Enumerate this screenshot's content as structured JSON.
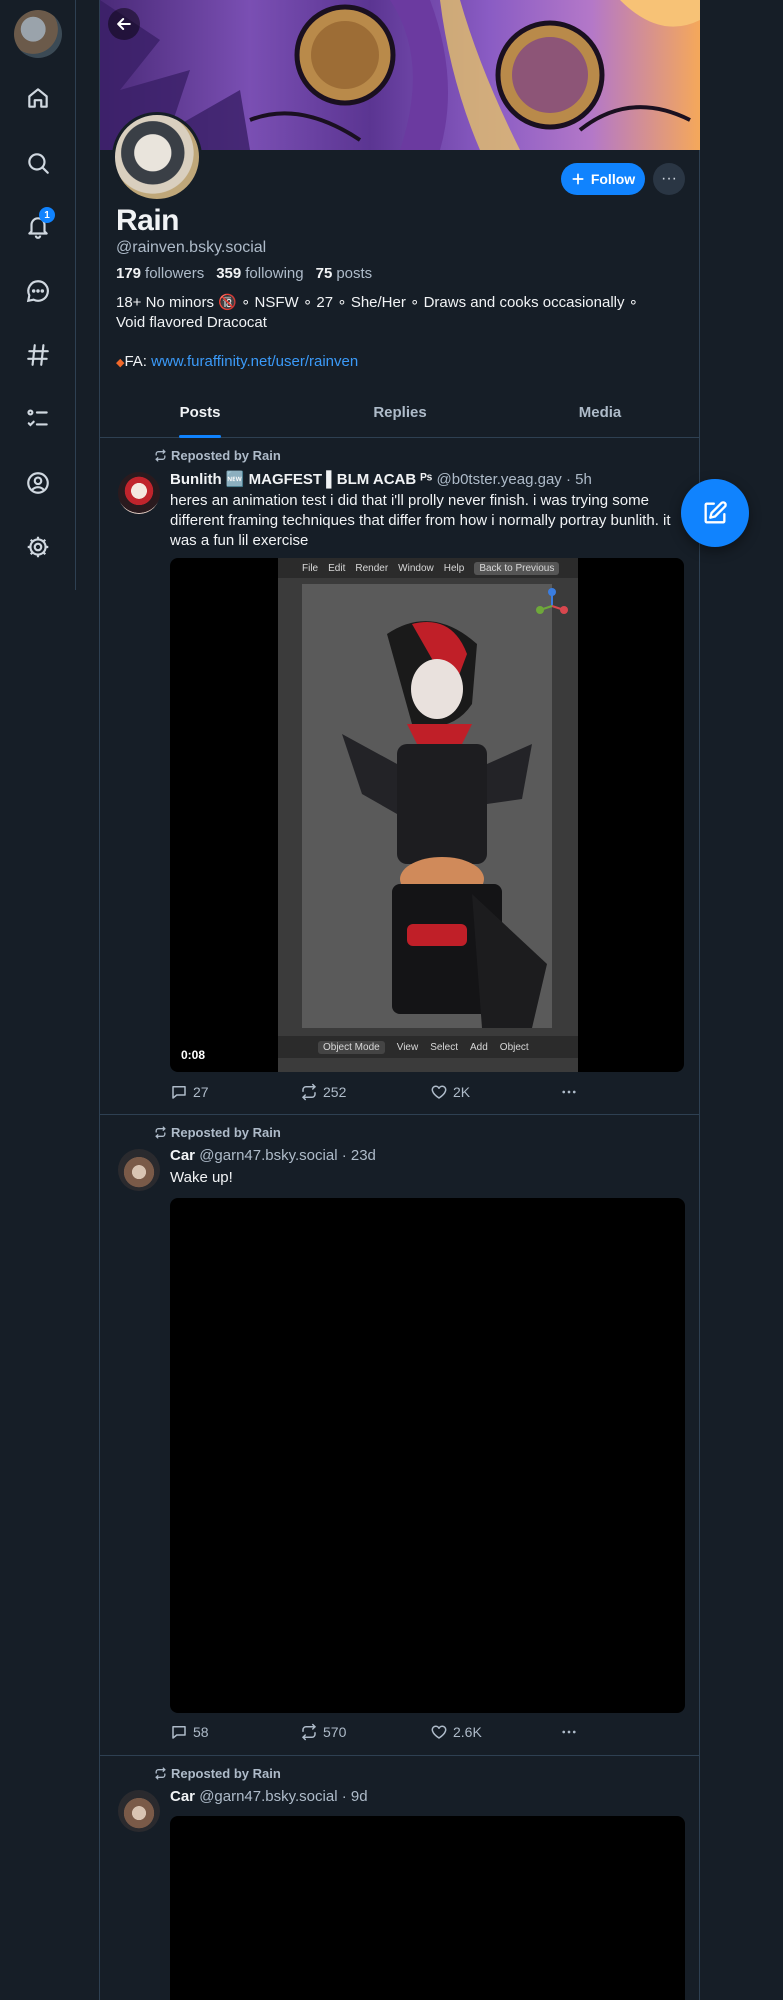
{
  "nav": {
    "notification_count": "1",
    "items": [
      "home",
      "search",
      "notifications",
      "chat",
      "feeds",
      "lists",
      "profile",
      "settings"
    ]
  },
  "profile": {
    "display_name": "Rain",
    "handle": "@rainven.bsky.social",
    "followers_count": "179",
    "followers_label": "followers",
    "following_count": "359",
    "following_label": "following",
    "posts_count": "75",
    "posts_label": "posts",
    "bio_line1": "18+ No minors 🔞 ∘ NSFW ∘ 27 ∘ She/Her ∘ Draws and cooks occasionally ∘",
    "bio_line2": "Void flavored Dracocat",
    "link_prefix": "FA: ",
    "link_url": "www.furaffinity.net/user/rainven",
    "follow_label": "Follow",
    "more_label": "···"
  },
  "tabs": [
    "Posts",
    "Replies",
    "Media"
  ],
  "posts": [
    {
      "repost_label": "Reposted by Rain",
      "author": "Bunlith 🆕 MAGFEST ▌BLM ACAB ᴾˢ",
      "meta": "@b0tster.yeag.gay · 5h",
      "text": "heres an animation test i did that i'll prolly never finish. i was trying some different framing techniques that differ from how i normally portray bunlith. it was a fun lil exercise",
      "video_time": "0:08",
      "blender_menu": [
        "File",
        "Edit",
        "Render",
        "Window",
        "Help"
      ],
      "blender_back": "Back to Previous",
      "blender_mode": "Object Mode",
      "blender_bottom": [
        "View",
        "Select",
        "Add",
        "Object"
      ],
      "replies": "27",
      "reposts": "252",
      "likes": "2K"
    },
    {
      "repost_label": "Reposted by Rain",
      "author": "Car",
      "meta": "@garn47.bsky.social · 23d",
      "text": "Wake up!",
      "replies": "58",
      "reposts": "570",
      "likes": "2.6K"
    },
    {
      "repost_label": "Reposted by Rain",
      "author": "Car",
      "meta": "@garn47.bsky.social · 9d"
    }
  ],
  "colors": {
    "background": "#161e27",
    "accent": "#1083fe",
    "muted": "#aebbc9",
    "link": "#3b9af8"
  },
  "icons": [
    "arrow-left-icon",
    "home-icon",
    "search-icon",
    "bell-icon",
    "chat-bubble-icon",
    "hashtag-icon",
    "list-icon",
    "user-circle-icon",
    "gear-icon",
    "repost-icon",
    "reply-icon",
    "heart-icon",
    "ellipsis-icon",
    "compose-icon",
    "plus-icon"
  ]
}
